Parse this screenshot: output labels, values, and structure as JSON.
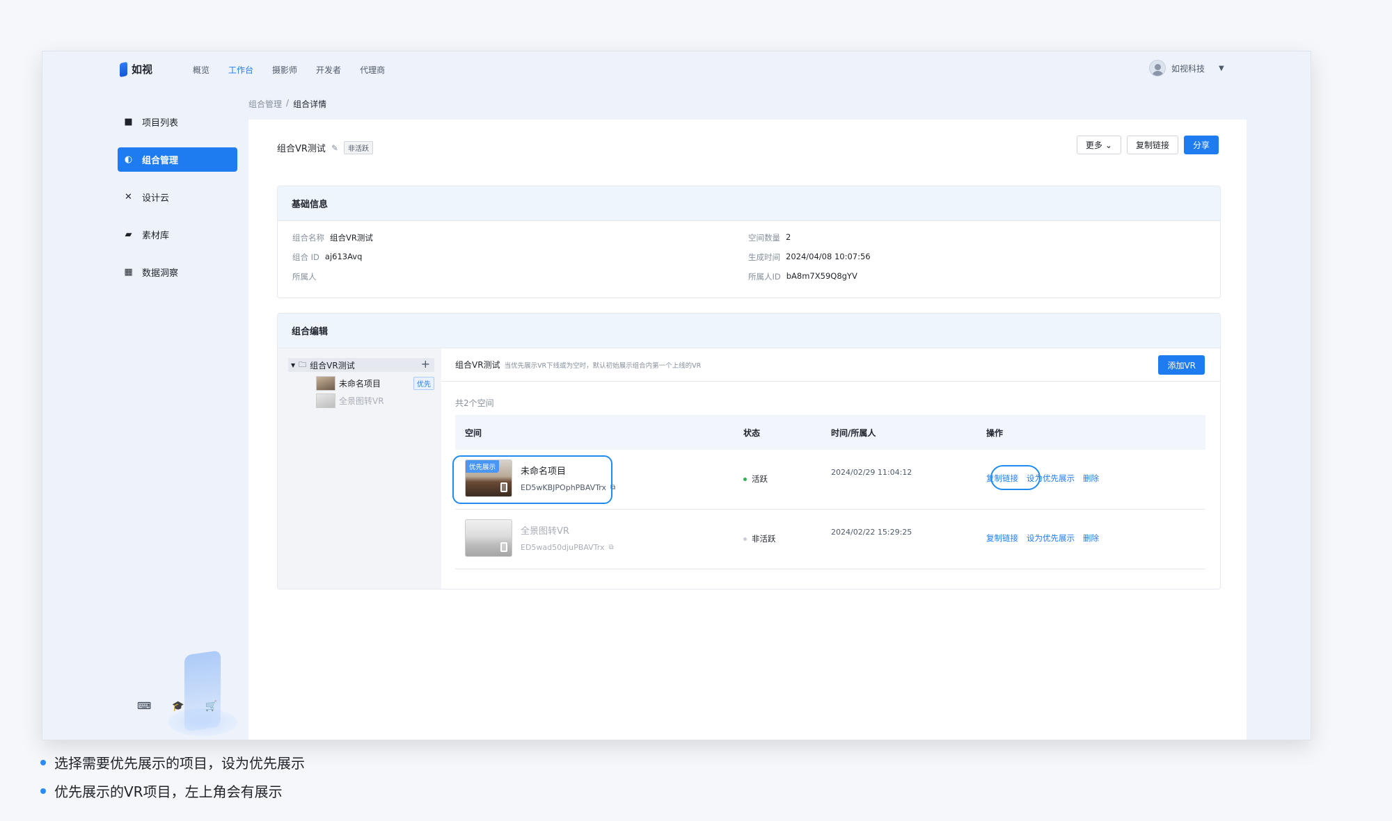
{
  "app": {
    "logo_text": "如视"
  },
  "nav": [
    {
      "label": "概览",
      "active": false
    },
    {
      "label": "工作台",
      "active": true
    },
    {
      "label": "摄影师",
      "active": false
    },
    {
      "label": "开发者",
      "active": false
    },
    {
      "label": "代理商",
      "active": false
    }
  ],
  "user": {
    "name": "如视科技"
  },
  "sidebar": {
    "items": [
      {
        "label": "项目列表",
        "icon": "video-icon"
      },
      {
        "label": "组合管理",
        "icon": "combine-icon",
        "active": true
      },
      {
        "label": "设计云",
        "icon": "tools-icon"
      },
      {
        "label": "素材库",
        "icon": "folder-icon"
      },
      {
        "label": "数据洞察",
        "icon": "chart-icon"
      }
    ]
  },
  "breadcrumb": {
    "parent": "组合管理",
    "separator": "/",
    "current": "组合详情"
  },
  "header": {
    "title": "组合VR测试",
    "status_badge": "非活跃",
    "more_label": "更多",
    "copy_link_label": "复制链接",
    "share_label": "分享"
  },
  "basic_info": {
    "heading": "基础信息",
    "name_key": "组合名称",
    "name_val": "组合VR测试",
    "id_key": "组合 ID",
    "id_val": "aj613Avq",
    "owner_key": "所属人",
    "owner_val": "",
    "space_count_key": "空间数量",
    "space_count_val": "2",
    "created_key": "生成时间",
    "created_val": "2024/04/08 10:07:56",
    "owner_id_key": "所属人ID",
    "owner_id_val": "bA8m7X59Q8gYV"
  },
  "combo_edit": {
    "heading": "组合编辑",
    "tree": {
      "root": "组合VR测试",
      "items": [
        {
          "label": "未命名项目",
          "tag": "优先"
        },
        {
          "label": "全景图转VR",
          "tag": ""
        }
      ]
    },
    "panel": {
      "name": "组合VR测试",
      "hint": "当优先展示VR下线或为空时，默认初始展示组合内第一个上线的VR",
      "add_label": "添加VR",
      "count_text": "共2个空间"
    },
    "columns": [
      "空间",
      "状态",
      "时间/所属人",
      "操作"
    ],
    "rows": [
      {
        "priority_label": "优先展示",
        "name": "未命名项目",
        "id": "ED5wKBJPOphPBAVTrx",
        "status": "活跃",
        "time": "2024/02/29 11:04:12",
        "ops": [
          "复制链接",
          "设为优先展示",
          "删除"
        ]
      },
      {
        "priority_label": "",
        "name": "全景图转VR",
        "id": "ED5wad50djuPBAVTrx",
        "status": "非活跃",
        "time": "2024/02/22 15:29:25",
        "ops": [
          "复制链接",
          "设为优先展示",
          "删除"
        ]
      }
    ]
  },
  "notes": [
    "选择需要优先展示的项目，设为优先展示",
    "优先展示的VR项目，左上角会有展示"
  ],
  "colors": {
    "accent": "#1f7cf0",
    "highlight": "#1f8bf0",
    "active_dot": "#2bb24c"
  }
}
